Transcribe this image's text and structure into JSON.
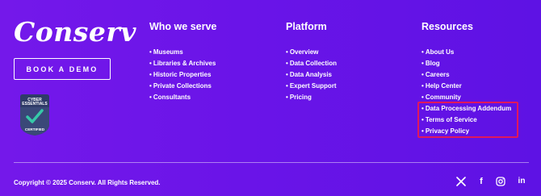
{
  "brand": {
    "logo_text": "Conserv",
    "demo_button": "BOOK A DEMO",
    "badge": {
      "line1": "CYBER",
      "line2": "ESSENTIALS",
      "line3": "CERTIFIED"
    }
  },
  "columns": [
    {
      "title": "Who we serve",
      "links": [
        "Museums",
        "Libraries & Archives",
        "Historic Properties",
        "Private Collections",
        "Consultants"
      ]
    },
    {
      "title": "Platform",
      "links": [
        "Overview",
        "Data Collection",
        "Data Analysis",
        "Expert Support",
        "Pricing"
      ]
    },
    {
      "title": "Resources",
      "links": [
        "About Us",
        "Blog",
        "Careers",
        "Help Center",
        "Community",
        "Data Processing Addendum",
        "Terms of Service",
        "Privacy Policy"
      ]
    }
  ],
  "bullet": "•",
  "highlight_color": "#e0185c",
  "background_color": "#6a14e8",
  "footer": {
    "copyright": "Copyright © 2025 Conserv. All Rights Reserved.",
    "social_icons": [
      "x-icon",
      "facebook-icon",
      "instagram-icon",
      "linkedin-icon"
    ],
    "social_glyphs": {
      "facebook": "f",
      "linkedin": "in"
    }
  }
}
